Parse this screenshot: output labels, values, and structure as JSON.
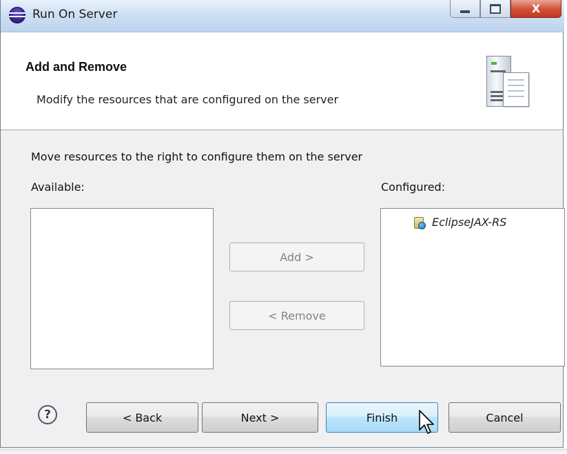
{
  "window": {
    "title": "Run On Server",
    "controls": {
      "minimize": "minimize",
      "maximize": "maximize",
      "close": "X"
    }
  },
  "header": {
    "title": "Add and Remove",
    "description": "Modify the resources that are configured on the server"
  },
  "main": {
    "instruction": "Move resources to the right to configure them on the server",
    "available_label": "Available:",
    "available_items": [],
    "configured_label": "Configured:",
    "configured_items": [
      {
        "label": "EclipseJAX-RS",
        "icon": "web-project-icon"
      }
    ],
    "add_button": "Add >",
    "remove_button": "< Remove",
    "add_enabled": false,
    "remove_enabled": false
  },
  "footer": {
    "help_icon": "?",
    "back_button": "< Back",
    "next_button": "Next >",
    "finish_button": "Finish",
    "cancel_button": "Cancel",
    "focused_button": "finish"
  },
  "colors": {
    "titlebar": "#cfe0f4",
    "close_button": "#c2371e",
    "focused_button": "#bee6fd",
    "dialog_background": "#f0f0f0"
  }
}
